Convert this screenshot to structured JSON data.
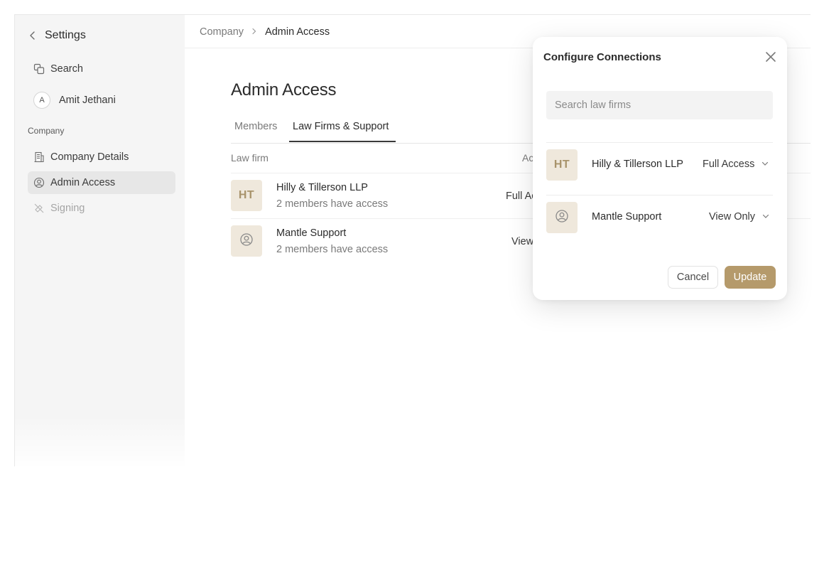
{
  "sidebar": {
    "title": "Settings",
    "search_label": "Search",
    "user": {
      "initial": "A",
      "name": "Amit Jethani"
    },
    "section_label": "Company",
    "items": [
      {
        "label": "Company Details",
        "icon": "building-icon"
      },
      {
        "label": "Admin Access",
        "icon": "user-circle-icon",
        "active": true
      },
      {
        "label": "Signing",
        "icon": "signature-icon",
        "disabled": true
      }
    ]
  },
  "breadcrumb": {
    "parent": "Company",
    "current": "Admin Access"
  },
  "page": {
    "title": "Admin Access",
    "tabs": [
      {
        "label": "Members",
        "active": false
      },
      {
        "label": "Law Firms & Support",
        "active": true
      }
    ],
    "columns": {
      "law_firm": "Law firm",
      "access": "Ac"
    },
    "rows": [
      {
        "logo": "HT",
        "name": "Hilly & Tillerson LLP",
        "sub": "2 members have access",
        "access": "Full Ac"
      },
      {
        "logo_icon": "user-circle-icon",
        "name": "Mantle Support",
        "sub": "2 members have access",
        "access": "View"
      }
    ]
  },
  "modal": {
    "title": "Configure Connections",
    "search_placeholder": "Search law firms",
    "connections": [
      {
        "logo": "HT",
        "name": "Hilly & Tillerson LLP",
        "access": "Full Access"
      },
      {
        "logo_icon": "user-circle-icon",
        "name": "Mantle Support",
        "access": "View Only"
      }
    ],
    "cancel_label": "Cancel",
    "update_label": "Update"
  },
  "colors": {
    "accent": "#b59a6b",
    "logo_bg": "#efe8dc",
    "logo_text": "#a8936b",
    "sidebar_bg": "#f5f5f5",
    "active_item_bg": "#e7e7e7"
  }
}
